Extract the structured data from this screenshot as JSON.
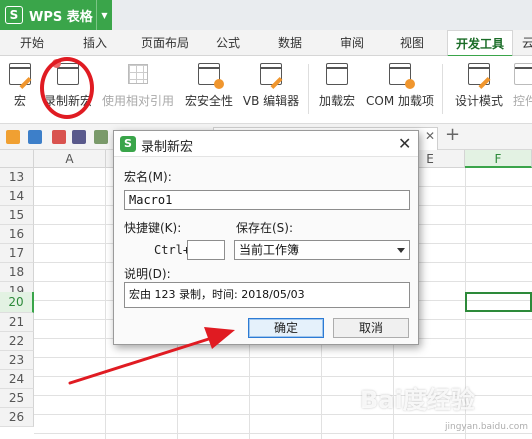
{
  "app": {
    "name": "WPS 表格",
    "logo": "S"
  },
  "tabs": [
    {
      "label": "开始"
    },
    {
      "label": "插入"
    },
    {
      "label": "页面布局"
    },
    {
      "label": "公式"
    },
    {
      "label": "数据"
    },
    {
      "label": "审阅"
    },
    {
      "label": "视图"
    },
    {
      "label": "开发工具"
    },
    {
      "label": "云"
    }
  ],
  "ribbon": {
    "macro": "宏",
    "record_macro": "录制新宏",
    "relative_ref": "使用相对引用",
    "macro_security": "宏安全性",
    "vb_editor": "VB 编辑器",
    "load_macro": "加载宏",
    "com_addins": "COM 加载项",
    "design_mode": "设计模式",
    "controls": "控件"
  },
  "sheet": {
    "columns": [
      "A",
      "E",
      "F"
    ],
    "rows": [
      "13",
      "14",
      "15",
      "16",
      "17",
      "18",
      "19",
      "20",
      "21",
      "22",
      "23",
      "24",
      "25",
      "26"
    ],
    "selected_row": "20",
    "selected_column": "F"
  },
  "dialog": {
    "title": "录制新宏",
    "macro_name_label": "宏名(M):",
    "macro_name_value": "Macro1",
    "shortcut_label": "快捷键(K):",
    "ctrl_prefix": "Ctrl+",
    "shortcut_value": "",
    "store_in_label": "保存在(S):",
    "store_in_value": "当前工作簿",
    "description_label": "说明(D):",
    "description_value": "宏由 123 录制，时间: 2018/05/03",
    "ok_label": "确定",
    "cancel_label": "取消"
  },
  "watermark": {
    "main": "Bai度经验",
    "sub": "jingyan.baidu.com"
  }
}
